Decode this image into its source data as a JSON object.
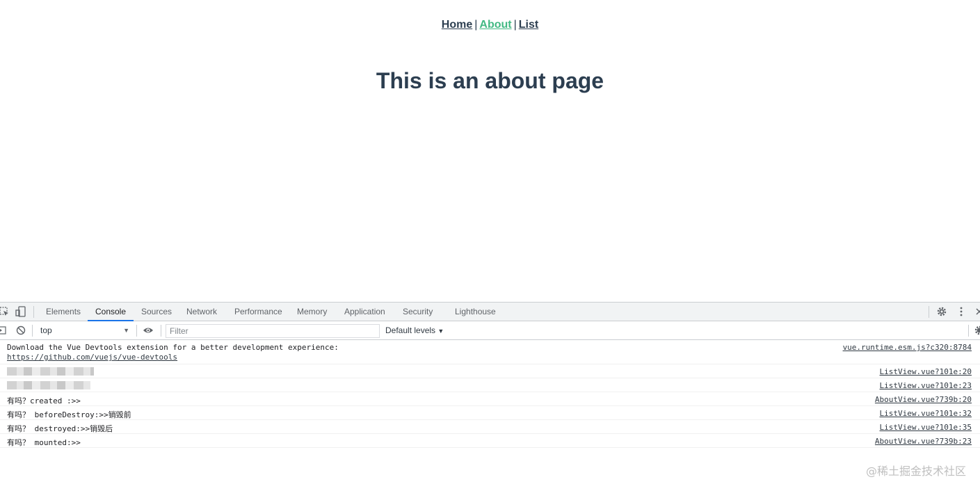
{
  "nav": {
    "links": [
      {
        "label": "Home"
      },
      {
        "label": "About"
      },
      {
        "label": "List"
      }
    ],
    "separator": "|",
    "active_color": "#42b983",
    "text_color": "#2c3e50"
  },
  "page": {
    "heading": "This is an about page"
  },
  "devtools": {
    "tabs": [
      "Elements",
      "Console",
      "Sources",
      "Network",
      "Performance",
      "Memory",
      "Application",
      "Security",
      "Lighthouse"
    ],
    "active_tab": "Console",
    "context": "top",
    "filter_placeholder": "Filter",
    "levels": "Default levels",
    "icons": [
      "inspect-icon",
      "device-toggle-icon",
      "settings-icon",
      "more-icon",
      "close-icon",
      "sidebar-icon",
      "clear-icon",
      "eye-icon"
    ]
  },
  "console": {
    "rows": [
      {
        "message": "Download the Vue Devtools extension for a better development experience:",
        "link": "https://github.com/vuejs/vue-devtools",
        "source": "vue.runtime.esm.js?c320:8784"
      },
      {
        "message": "",
        "source": "ListView.vue?101e:20"
      },
      {
        "message": "",
        "source": "ListView.vue?101e:23"
      },
      {
        "message": "有吗？created :>>",
        "source": "AboutView.vue?739b:20"
      },
      {
        "message": "有吗？ beforeDestroy:>>销毁前",
        "source": "ListView.vue?101e:32"
      },
      {
        "message": "有吗？ destroyed:>>销毁后",
        "source": "ListView.vue?101e:35"
      },
      {
        "message": "有吗？ mounted:>>",
        "source": "AboutView.vue?739b:23"
      }
    ]
  },
  "watermark": "@稀土掘金技术社区"
}
